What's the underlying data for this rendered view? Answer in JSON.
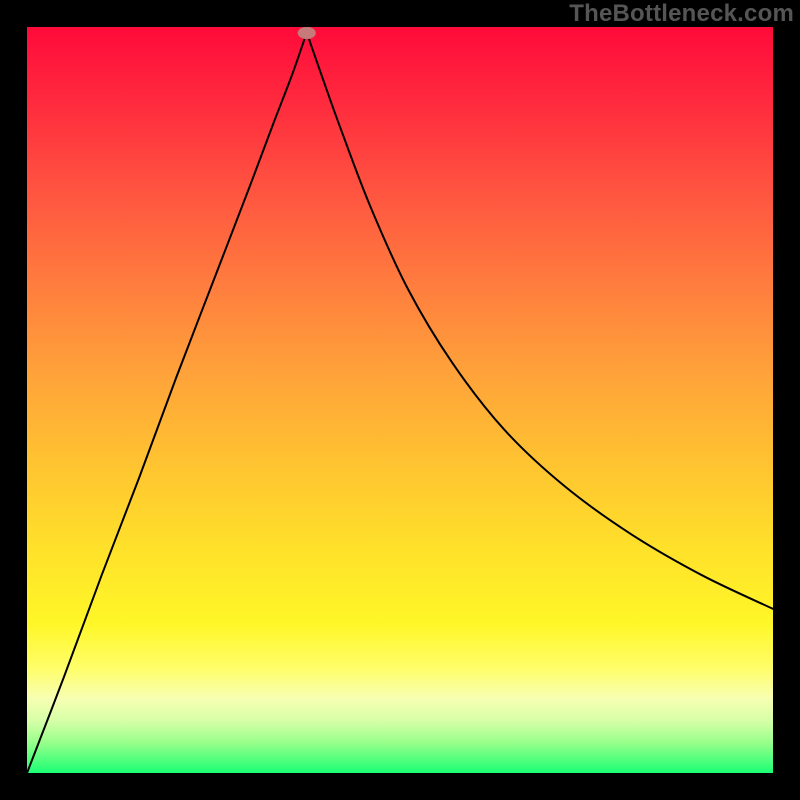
{
  "watermark": "TheBottleneck.com",
  "plot": {
    "x_range": [
      0,
      746
    ],
    "y_range": [
      0,
      746
    ],
    "marker": {
      "x_frac": 0.375,
      "y_frac": 0.992
    }
  },
  "chart_data": {
    "type": "line",
    "title": "",
    "xlabel": "",
    "ylabel": "",
    "series": [
      {
        "name": "bottleneck-curve",
        "x_fraction": [
          0.0,
          0.05,
          0.1,
          0.15,
          0.2,
          0.25,
          0.3,
          0.33,
          0.355,
          0.37,
          0.375,
          0.38,
          0.395,
          0.42,
          0.46,
          0.51,
          0.57,
          0.64,
          0.72,
          0.81,
          0.905,
          1.0
        ],
        "y_fraction": [
          0.0,
          0.13,
          0.265,
          0.395,
          0.53,
          0.66,
          0.79,
          0.87,
          0.935,
          0.978,
          0.992,
          0.978,
          0.935,
          0.865,
          0.76,
          0.65,
          0.55,
          0.46,
          0.385,
          0.32,
          0.265,
          0.22
        ]
      }
    ],
    "marker": {
      "x_fraction": 0.375,
      "y_fraction": 0.992,
      "shape": "ellipse",
      "color": "#c77a79"
    },
    "background_gradient": {
      "type": "vertical",
      "stops": [
        {
          "pos": 0.0,
          "color": "#ff0a3a"
        },
        {
          "pos": 0.5,
          "color": "#ffa63a"
        },
        {
          "pos": 0.8,
          "color": "#fff728"
        },
        {
          "pos": 1.0,
          "color": "#1aff74"
        }
      ]
    },
    "frame_color": "#000000",
    "xlim_frac": [
      0,
      1
    ],
    "ylim_frac": [
      0,
      1
    ]
  }
}
